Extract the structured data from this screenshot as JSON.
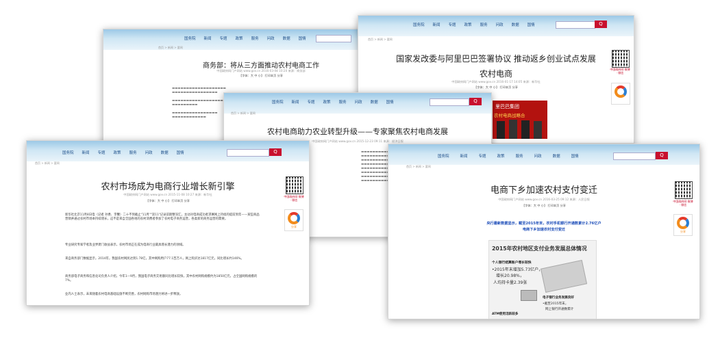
{
  "nav_items": [
    "国务院",
    "新闻",
    "专题",
    "政策",
    "服务",
    "问政",
    "数据",
    "国情"
  ],
  "search_button": "Q",
  "crumb": "首页 > 新闻 > 要闻",
  "cards": {
    "c1": {
      "title": "商务部：将从三方面推动农村电商工作",
      "meta": "中国政府网门户网站 www.gov.cn 2016-03-08 10:20 来源：商务部",
      "meta2": "【字体：大 中 小】 打印本页 分享"
    },
    "c2": {
      "title_line1": "国家发改委与阿里巴巴签署协议 推动返乡创业试点发展",
      "title_line2": "农村电商",
      "meta": "中国政府网门户网站 www.gov.cn 2016-01-17 14:05 来源：新华社",
      "meta2": "【字体：大 中 小】 打印本页 分享",
      "photo_text_1": "里巴巴集团",
      "photo_text_2": "农村电商战略合"
    },
    "c3": {
      "title": "农村电商助力农业转型升级——专家聚焦农村电商发展",
      "meta": "中国政府网门户网站 www.gov.cn 2015-12-23 09:11 来源：经济日报",
      "meta2": "【字体：大 中 小】 打印本页 分享"
    },
    "c4": {
      "title": "农村市场成为电商行业增长新引擎",
      "meta": "中国政府网门户网站 www.gov.cn 2015-11-08 10:27 来源：新华社",
      "meta2": "【字体：大 中 小】 打印本页 分享",
      "paragraphs": [
        "新华社北京11月8日电（记者 孙勇、李馨）二十不到截止\"11月\"\"双11\"记录前期整深汇，主动对电商成功者求赛网上持续的提前到年——某些商品营销并通过农村市场本持续增长，这不是来自全国各地的农村消费者参加了农村电子商务运营，各类新的商务运营的需要。",
        "专业研究专家学者及业界建门收益表示，农村市场正在成为电商行业最具增长潜力的领域。",
        "来自商务部门数据显示，2014年，我国农村网民达到1.78亿，其中网购用户77.1百万人，网上购买达1817亿元，同比增长约146%。",
        "商务部电子商务和信息化司负责人介绍，今年1—9月，我国电子商务交易额同比增长较快，其中农村网购规模约为1850亿元，占全国网购规模的7%。",
        "业内人士表示，未来随着农村电商基础设施不断完善，农村网购市场潜力将进一步释放。"
      ]
    },
    "c5": {
      "title": "电商下乡加速农村支付变迁",
      "meta": "中国政府网门户网站 www.gov.cn 2016-03-25 09:12 来源：人民日报",
      "meta2": "【字体：大 中 小】 打印本页 分享",
      "red_line1": "央行最新数据显示，截至2015年末，农村手机银行开通数累计2.76亿户",
      "red_line2": "电商下乡加速农村支付变迁",
      "infographic": {
        "title": "2015年农村地区支付业务发展总体情况",
        "item1": "个人银行结算账户增长较快",
        "item1_a": "•2015年末增加5.73亿户，",
        "item1_b": "增长20.98%，",
        "item1_c": "人均持卡量2.39张",
        "item2": "电子银行业务发展良好",
        "item2_a": "•截至2015年末，",
        "item2_b": "网上银行开通数累计",
        "item3": "ATM使用活跃较多"
      }
    }
  },
  "qr_caption": "中国政府网 微博 · 微信",
  "logo_caption": "分享",
  "colors": {
    "accent_red": "#c8102e",
    "header_blue": "#9cc9e6",
    "nav_text": "#1d4f8a"
  }
}
